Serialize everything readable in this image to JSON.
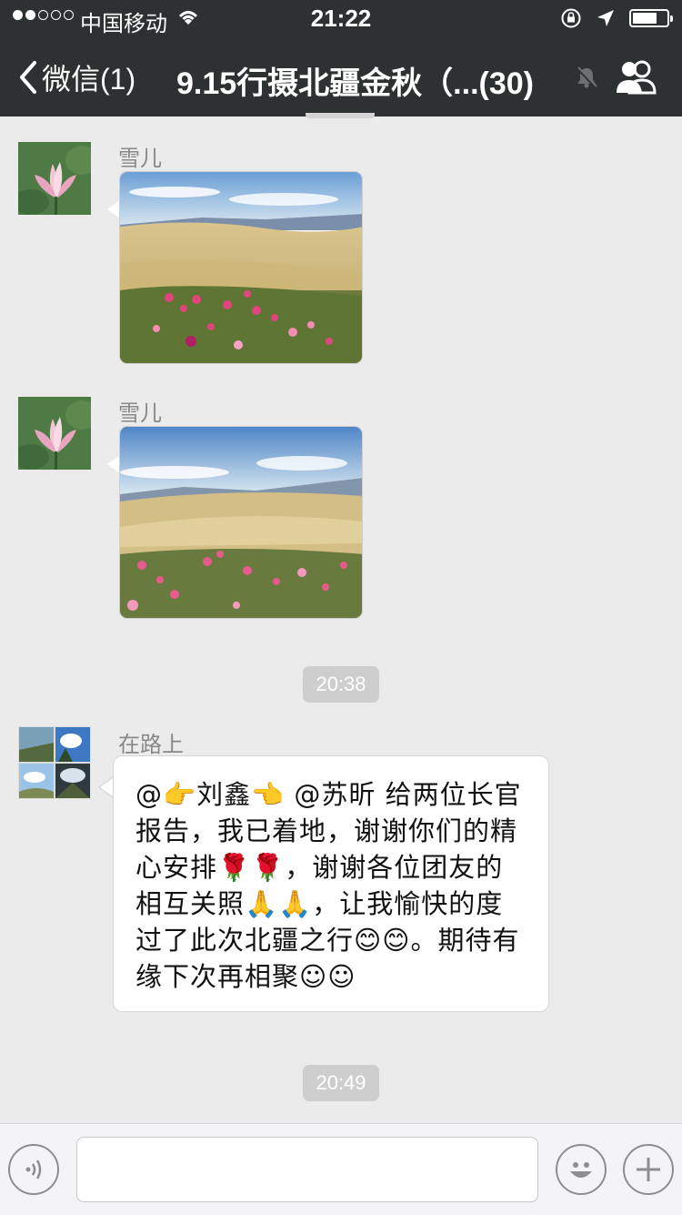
{
  "status_bar": {
    "carrier": "中国移动",
    "time": "21:22"
  },
  "nav": {
    "back_label": "微信(1)",
    "title": "9.15行摄北疆金秋（...(30)"
  },
  "messages": [
    {
      "sender": "雪儿",
      "type": "image",
      "scene": "golden wheat hills with pink and magenta cosmos flowers under blue sky"
    },
    {
      "sender": "雪儿",
      "type": "image",
      "scene": "rolling golden fields and distant mountains with pink cosmos flowers in foreground"
    },
    {
      "type": "timestamp",
      "text": "20:38"
    },
    {
      "sender": "在路上",
      "type": "text",
      "text": "@👉刘鑫👈 @苏昕 给两位长官报告，我已着地，谢谢你们的精心安排🌹🌹，谢谢各位团友的相互关照🙏🙏，让我愉快的度过了此次北疆之行😊😊。期待有缘下次再相聚☺☺"
    },
    {
      "type": "timestamp",
      "text": "20:49"
    }
  ],
  "input_bar": {
    "placeholder": ""
  },
  "colors": {
    "nav_bg": "#2e3132",
    "chat_bg": "#ebebeb",
    "timestamp_bg": "#cecece"
  },
  "icons": [
    "wifi-icon",
    "lock-rotation-icon",
    "location-arrow-icon",
    "battery-icon",
    "back-chevron-icon",
    "mute-bell-icon",
    "group-people-icon",
    "voice-icon",
    "emoji-icon",
    "plus-icon"
  ]
}
